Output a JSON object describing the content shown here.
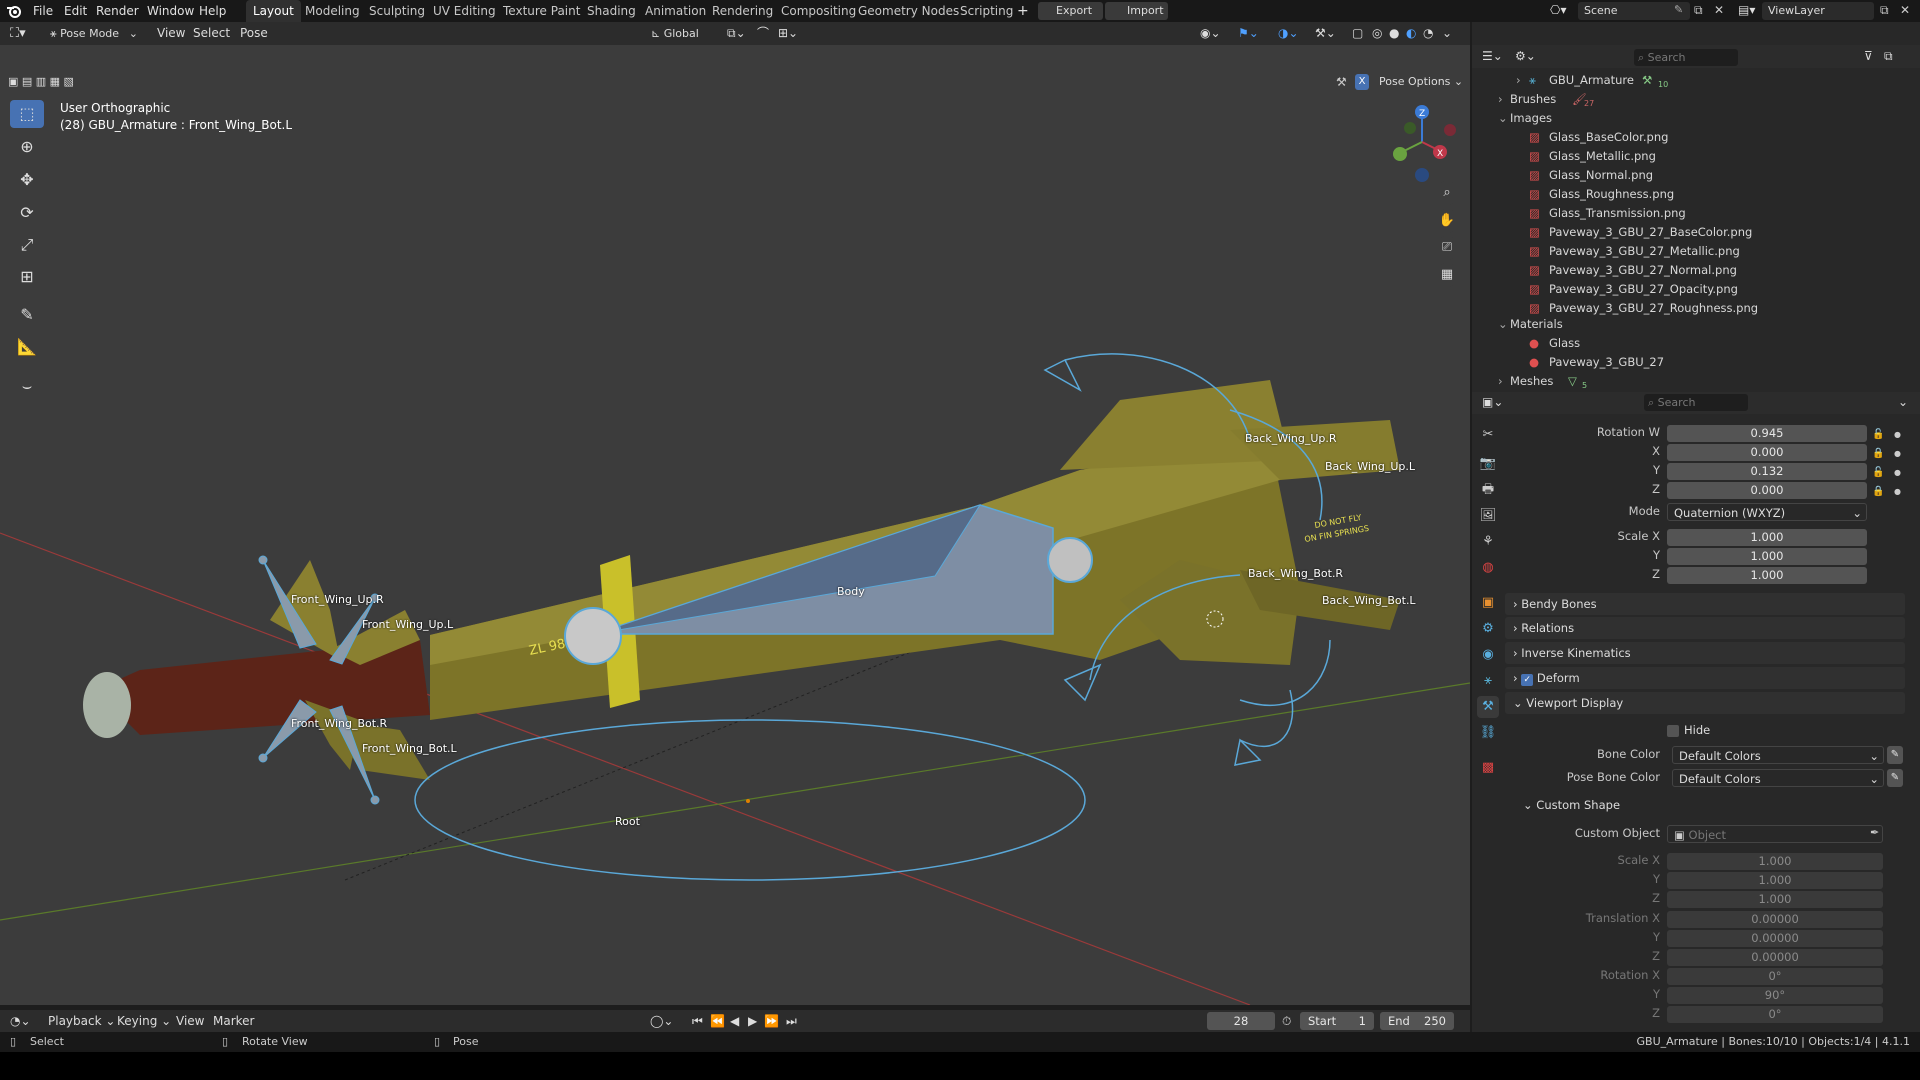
{
  "menus": [
    "File",
    "Edit",
    "Render",
    "Window",
    "Help"
  ],
  "workspaces": [
    "Layout",
    "Modeling",
    "Sculpting",
    "UV Editing",
    "Texture Paint",
    "Shading",
    "Animation",
    "Rendering",
    "Compositing",
    "Geometry Nodes",
    "Scripting"
  ],
  "export_label": "Export",
  "import_label": "Import",
  "scene": "Scene",
  "view_layer": "ViewLayer",
  "viewport": {
    "mode": "Pose Mode",
    "menus": [
      "View",
      "Select",
      "Pose"
    ],
    "orientation": "Global",
    "pose_options": "Pose Options",
    "view_name": "User Orthographic",
    "active_info": "(28) GBU_Armature : Front_Wing_Bot.L",
    "bone_labels": [
      "Body",
      "Root",
      "Front_Wing_Up.R",
      "Front_Wing_Up.L",
      "Front_Wing_Bot.R",
      "Front_Wing_Bot.L",
      "Back_Wing_Up.R",
      "Back_Wing_Up.L",
      "Back_Wing_Bot.R",
      "Back_Wing_Bot.L"
    ],
    "decal_text": [
      "ZL 98",
      "DO NOT FLY",
      "ON FIN SPRINGS"
    ]
  },
  "outliner": {
    "search_placeholder": "Search",
    "armature": "GBU_Armature",
    "armature_count": "10",
    "brushes": "Brushes",
    "brushes_count": "27",
    "images_label": "Images",
    "images": [
      "Glass_BaseColor.png",
      "Glass_Metallic.png",
      "Glass_Normal.png",
      "Glass_Roughness.png",
      "Glass_Transmission.png",
      "Paveway_3_GBU_27_BaseColor.png",
      "Paveway_3_GBU_27_Metallic.png",
      "Paveway_3_GBU_27_Normal.png",
      "Paveway_3_GBU_27_Opacity.png",
      "Paveway_3_GBU_27_Roughness.png"
    ],
    "materials_label": "Materials",
    "materials": [
      "Glass",
      "Paveway_3_GBU_27"
    ],
    "meshes": "Meshes",
    "meshes_count": "5"
  },
  "properties": {
    "search_placeholder": "Search",
    "rotation_w_label": "Rotation W",
    "rotation_w": "0.945",
    "x_label": "X",
    "rotation_x": "0.000",
    "y_label": "Y",
    "rotation_y": "0.132",
    "z_label": "Z",
    "rotation_z": "0.000",
    "mode_label": "Mode",
    "mode_value": "Quaternion (WXYZ)",
    "scale_x_label": "Scale X",
    "scale_x": "1.000",
    "scale_y": "1.000",
    "scale_z": "1.000",
    "sections": [
      "Bendy Bones",
      "Relations",
      "Inverse Kinematics",
      "Deform",
      "Viewport Display"
    ],
    "hide_label": "Hide",
    "bone_color_label": "Bone Color",
    "bone_color": "Default Colors",
    "pose_bone_color_label": "Pose Bone Color",
    "pose_bone_color": "Default Colors",
    "custom_shape_label": "Custom Shape",
    "custom_object_label": "Custom Object",
    "custom_object_placeholder": "Object",
    "cs_scale_x_label": "Scale X",
    "cs_scale_x": "1.000",
    "cs_scale_y": "1.000",
    "cs_scale_z": "1.000",
    "translation_x_label": "Translation X",
    "translation_x": "0.00000",
    "translation_y": "0.00000",
    "translation_z": "0.00000",
    "cs_rotation_x_label": "Rotation X",
    "cs_rotation_x": "0°",
    "cs_rotation_y": "90°",
    "cs_rotation_z": "0°"
  },
  "timeline": {
    "menus": [
      "Playback",
      "Keying",
      "View",
      "Marker"
    ],
    "current_frame": "28",
    "start_label": "Start",
    "start": "1",
    "end_label": "End",
    "end": "250"
  },
  "status": {
    "select": "Select",
    "rotate_view": "Rotate View",
    "pose": "Pose",
    "info": "GBU_Armature | Bones:10/10 | Objects:1/4 | 4.1.1"
  },
  "colors": {
    "accent": "#4772b3",
    "body": "#8a8230",
    "bone": "#5aa8d8"
  }
}
